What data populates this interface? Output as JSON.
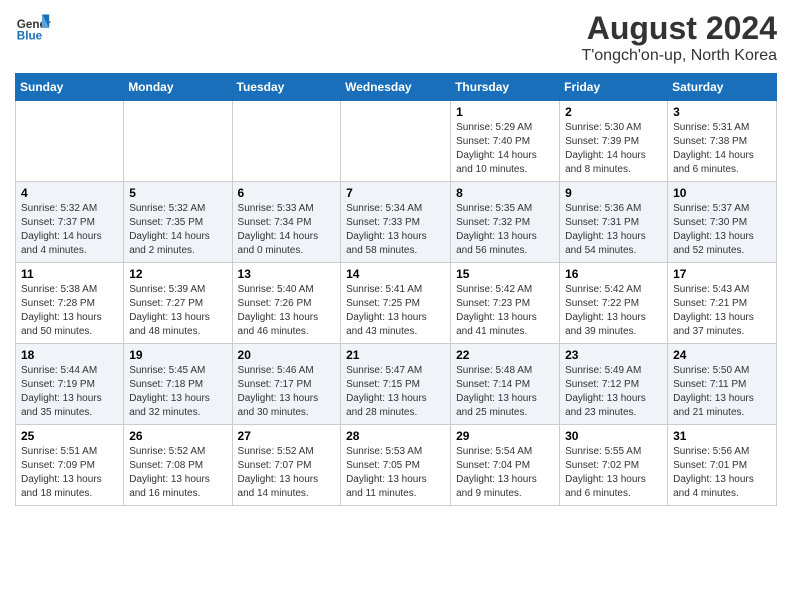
{
  "logo": {
    "name_part1": "General",
    "name_part2": "Blue"
  },
  "title": "August 2024",
  "subtitle": "T'ongch'on-up, North Korea",
  "weekdays": [
    "Sunday",
    "Monday",
    "Tuesday",
    "Wednesday",
    "Thursday",
    "Friday",
    "Saturday"
  ],
  "weeks": [
    [
      {
        "day": "",
        "info": ""
      },
      {
        "day": "",
        "info": ""
      },
      {
        "day": "",
        "info": ""
      },
      {
        "day": "",
        "info": ""
      },
      {
        "day": "1",
        "info": "Sunrise: 5:29 AM\nSunset: 7:40 PM\nDaylight: 14 hours\nand 10 minutes."
      },
      {
        "day": "2",
        "info": "Sunrise: 5:30 AM\nSunset: 7:39 PM\nDaylight: 14 hours\nand 8 minutes."
      },
      {
        "day": "3",
        "info": "Sunrise: 5:31 AM\nSunset: 7:38 PM\nDaylight: 14 hours\nand 6 minutes."
      }
    ],
    [
      {
        "day": "4",
        "info": "Sunrise: 5:32 AM\nSunset: 7:37 PM\nDaylight: 14 hours\nand 4 minutes."
      },
      {
        "day": "5",
        "info": "Sunrise: 5:32 AM\nSunset: 7:35 PM\nDaylight: 14 hours\nand 2 minutes."
      },
      {
        "day": "6",
        "info": "Sunrise: 5:33 AM\nSunset: 7:34 PM\nDaylight: 14 hours\nand 0 minutes."
      },
      {
        "day": "7",
        "info": "Sunrise: 5:34 AM\nSunset: 7:33 PM\nDaylight: 13 hours\nand 58 minutes."
      },
      {
        "day": "8",
        "info": "Sunrise: 5:35 AM\nSunset: 7:32 PM\nDaylight: 13 hours\nand 56 minutes."
      },
      {
        "day": "9",
        "info": "Sunrise: 5:36 AM\nSunset: 7:31 PM\nDaylight: 13 hours\nand 54 minutes."
      },
      {
        "day": "10",
        "info": "Sunrise: 5:37 AM\nSunset: 7:30 PM\nDaylight: 13 hours\nand 52 minutes."
      }
    ],
    [
      {
        "day": "11",
        "info": "Sunrise: 5:38 AM\nSunset: 7:28 PM\nDaylight: 13 hours\nand 50 minutes."
      },
      {
        "day": "12",
        "info": "Sunrise: 5:39 AM\nSunset: 7:27 PM\nDaylight: 13 hours\nand 48 minutes."
      },
      {
        "day": "13",
        "info": "Sunrise: 5:40 AM\nSunset: 7:26 PM\nDaylight: 13 hours\nand 46 minutes."
      },
      {
        "day": "14",
        "info": "Sunrise: 5:41 AM\nSunset: 7:25 PM\nDaylight: 13 hours\nand 43 minutes."
      },
      {
        "day": "15",
        "info": "Sunrise: 5:42 AM\nSunset: 7:23 PM\nDaylight: 13 hours\nand 41 minutes."
      },
      {
        "day": "16",
        "info": "Sunrise: 5:42 AM\nSunset: 7:22 PM\nDaylight: 13 hours\nand 39 minutes."
      },
      {
        "day": "17",
        "info": "Sunrise: 5:43 AM\nSunset: 7:21 PM\nDaylight: 13 hours\nand 37 minutes."
      }
    ],
    [
      {
        "day": "18",
        "info": "Sunrise: 5:44 AM\nSunset: 7:19 PM\nDaylight: 13 hours\nand 35 minutes."
      },
      {
        "day": "19",
        "info": "Sunrise: 5:45 AM\nSunset: 7:18 PM\nDaylight: 13 hours\nand 32 minutes."
      },
      {
        "day": "20",
        "info": "Sunrise: 5:46 AM\nSunset: 7:17 PM\nDaylight: 13 hours\nand 30 minutes."
      },
      {
        "day": "21",
        "info": "Sunrise: 5:47 AM\nSunset: 7:15 PM\nDaylight: 13 hours\nand 28 minutes."
      },
      {
        "day": "22",
        "info": "Sunrise: 5:48 AM\nSunset: 7:14 PM\nDaylight: 13 hours\nand 25 minutes."
      },
      {
        "day": "23",
        "info": "Sunrise: 5:49 AM\nSunset: 7:12 PM\nDaylight: 13 hours\nand 23 minutes."
      },
      {
        "day": "24",
        "info": "Sunrise: 5:50 AM\nSunset: 7:11 PM\nDaylight: 13 hours\nand 21 minutes."
      }
    ],
    [
      {
        "day": "25",
        "info": "Sunrise: 5:51 AM\nSunset: 7:09 PM\nDaylight: 13 hours\nand 18 minutes."
      },
      {
        "day": "26",
        "info": "Sunrise: 5:52 AM\nSunset: 7:08 PM\nDaylight: 13 hours\nand 16 minutes."
      },
      {
        "day": "27",
        "info": "Sunrise: 5:52 AM\nSunset: 7:07 PM\nDaylight: 13 hours\nand 14 minutes."
      },
      {
        "day": "28",
        "info": "Sunrise: 5:53 AM\nSunset: 7:05 PM\nDaylight: 13 hours\nand 11 minutes."
      },
      {
        "day": "29",
        "info": "Sunrise: 5:54 AM\nSunset: 7:04 PM\nDaylight: 13 hours\nand 9 minutes."
      },
      {
        "day": "30",
        "info": "Sunrise: 5:55 AM\nSunset: 7:02 PM\nDaylight: 13 hours\nand 6 minutes."
      },
      {
        "day": "31",
        "info": "Sunrise: 5:56 AM\nSunset: 7:01 PM\nDaylight: 13 hours\nand 4 minutes."
      }
    ]
  ]
}
